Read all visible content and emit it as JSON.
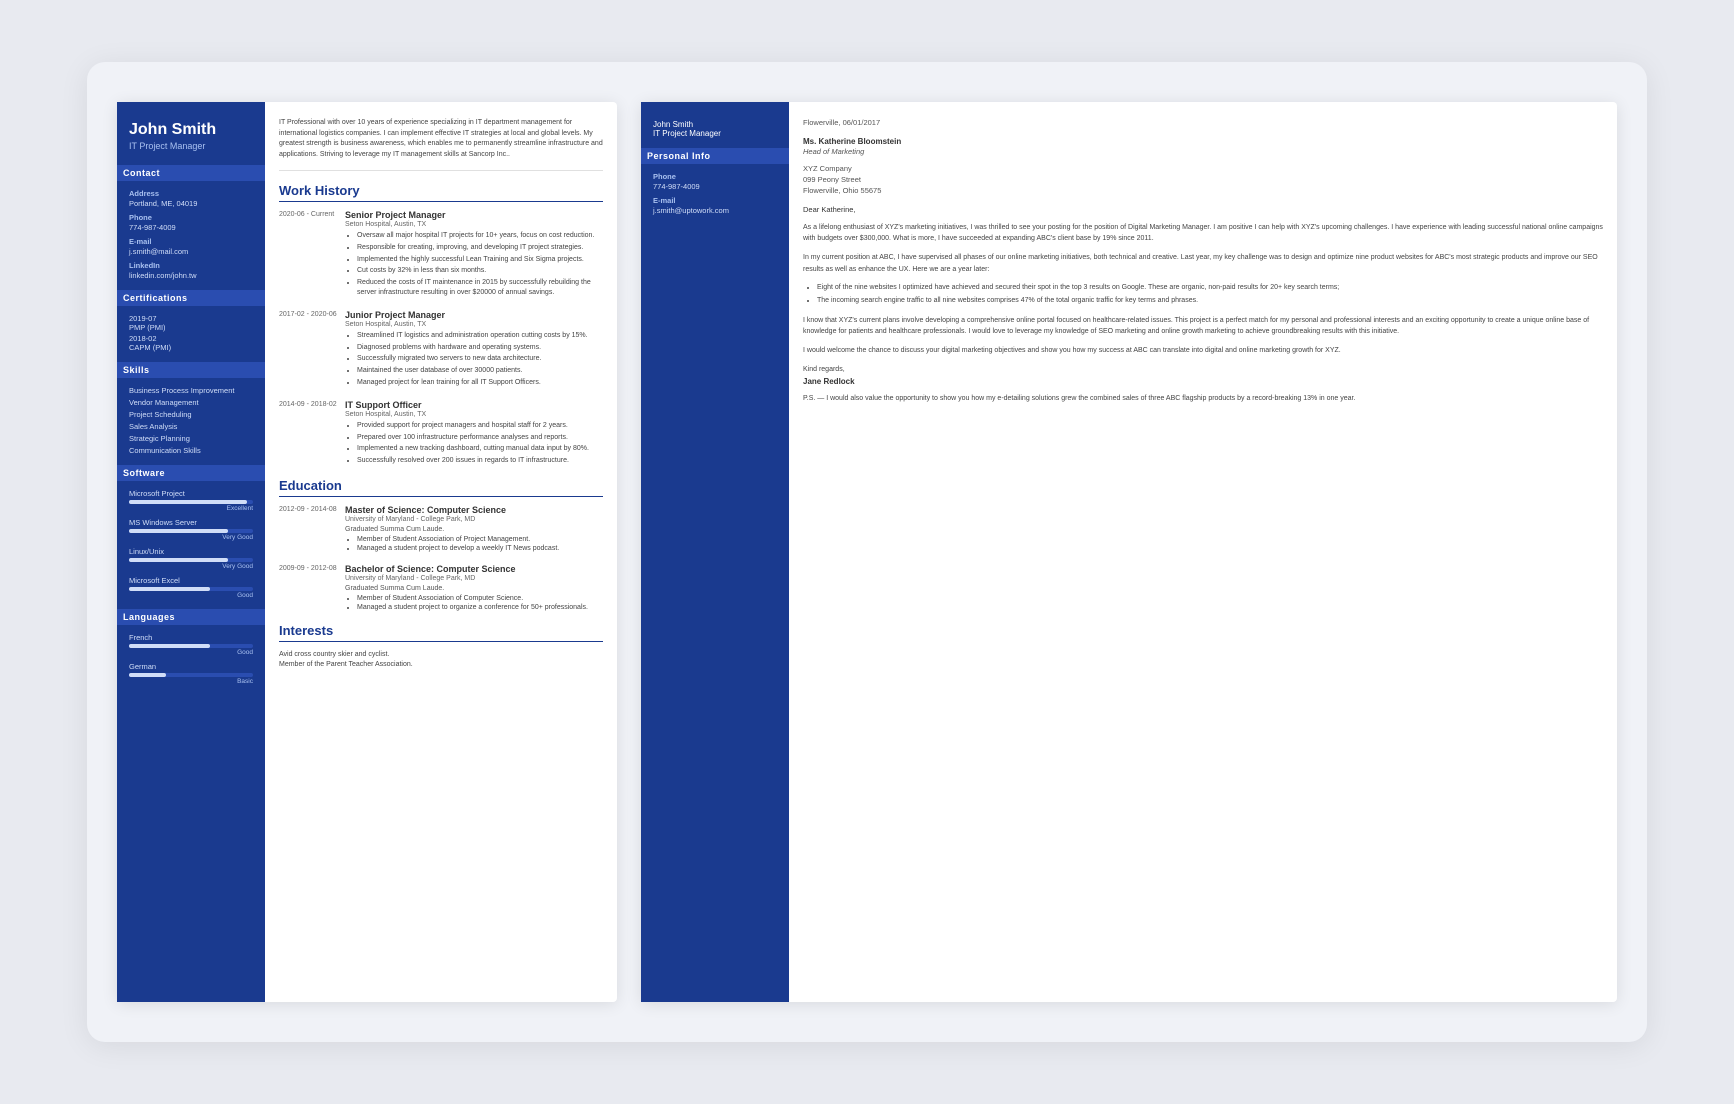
{
  "resume": {
    "name": "John Smith",
    "title": "IT Project Manager",
    "contact": {
      "section_label": "Contact",
      "address_label": "Address",
      "address_value": "Portland, ME, 04019",
      "phone_label": "Phone",
      "phone_value": "774-987-4009",
      "email_label": "E-mail",
      "email_value": "j.smith@mail.com",
      "linkedin_label": "LinkedIn",
      "linkedin_value": "linkedin.com/john.tw"
    },
    "certifications": {
      "section_label": "Certifications",
      "items": [
        {
          "date": "2019-07",
          "name": "PMP (PMI)"
        },
        {
          "date": "2018-02",
          "name": "CAPM (PMI)"
        }
      ]
    },
    "skills": {
      "section_label": "Skills",
      "items": [
        "Business Process Improvement",
        "Vendor Management",
        "Project Scheduling",
        "Sales Analysis",
        "Strategic Planning",
        "Communication Skills"
      ]
    },
    "software": {
      "section_label": "Software",
      "items": [
        {
          "name": "Microsoft Project",
          "level": "Excellent",
          "pct": 95
        },
        {
          "name": "MS Windows Server",
          "level": "Very Good",
          "pct": 80
        },
        {
          "name": "Linux/Unix",
          "level": "Very Good",
          "pct": 80
        },
        {
          "name": "Microsoft Excel",
          "level": "Good",
          "pct": 65
        }
      ]
    },
    "languages": {
      "section_label": "Languages",
      "items": [
        {
          "name": "French",
          "level": "Good",
          "pct": 65
        },
        {
          "name": "German",
          "level": "Basic",
          "pct": 30
        }
      ]
    },
    "summary": "IT Professional with over 10 years of experience specializing in IT department management for international logistics companies. I can implement effective IT strategies at local and global levels. My greatest strength is business awareness, which enables me to permanently streamline infrastructure and applications. Striving to leverage my IT management skills at Sancorp Inc..",
    "work_history": {
      "section_label": "Work History",
      "entries": [
        {
          "date": "2020-06 - Current",
          "title": "Senior Project Manager",
          "company": "Seton Hospital, Austin, TX",
          "bullets": [
            "Oversaw all major hospital IT projects for 10+ years, focus on cost reduction.",
            "Responsible for creating, improving, and developing IT project strategies.",
            "Implemented the highly successful Lean Training and Six Sigma projects.",
            "Cut costs by 32% in less than six months.",
            "Reduced the costs of IT maintenance in 2015 by successfully rebuilding the server infrastructure resulting in over $20000 of annual savings."
          ]
        },
        {
          "date": "2017-02 - 2020-06",
          "title": "Junior Project Manager",
          "company": "Seton Hospital, Austin, TX",
          "bullets": [
            "Streamlined IT logistics and administration operation cutting costs by 15%.",
            "Diagnosed problems with hardware and operating systems.",
            "Successfully migrated two servers to new data architecture.",
            "Maintained the user database of over 30000 patients.",
            "Managed project for lean training for all IT Support Officers."
          ]
        },
        {
          "date": "2014-09 - 2018-02",
          "title": "IT Support Officer",
          "company": "Seton Hospital, Austin, TX",
          "bullets": [
            "Provided support for project managers and hospital staff for 2 years.",
            "Prepared over 100 infrastructure performance analyses and reports.",
            "Implemented a new tracking dashboard, cutting manual data input by 80%.",
            "Successfully resolved over 200 issues in regards to IT infrastructure."
          ]
        }
      ]
    },
    "education": {
      "section_label": "Education",
      "entries": [
        {
          "date": "2012-09 - 2014-08",
          "degree": "Master of Science: Computer Science",
          "school": "University of Maryland - College Park, MD",
          "note": "Graduated Summa Cum Laude.",
          "bullets": [
            "Member of Student Association of Project Management.",
            "Managed a student project to develop a weekly IT News podcast."
          ]
        },
        {
          "date": "2009-09 - 2012-08",
          "degree": "Bachelor of Science: Computer Science",
          "school": "University of Maryland - College Park, MD",
          "note": "Graduated Summa Cum Laude.",
          "bullets": [
            "Member of Student Association of Computer Science.",
            "Managed a student project to organize a conference for 50+ professionals."
          ]
        }
      ]
    },
    "interests": {
      "section_label": "Interests",
      "text": "Avid cross country skier and cyclist.\nMember of the Parent Teacher Association."
    }
  },
  "cover_letter": {
    "name": "John Smith",
    "title": "IT Project Manager",
    "contact": {
      "section_label": "Personal Info",
      "phone_label": "Phone",
      "phone_value": "774-987-4009",
      "email_label": "E-mail",
      "email_value": "j.smith@uptowork.com"
    },
    "date": "Flowerville, 06/01/2017",
    "recipient": {
      "name": "Ms. Katherine Bloomstein",
      "title": "Head of Marketing",
      "company": "XYZ Company",
      "address1": "099 Peony Street",
      "address2": "Flowerville, Ohio 55675"
    },
    "greeting": "Dear Katherine,",
    "paragraphs": [
      "As a lifelong enthusiast of XYZ's marketing initiatives, I was thrilled to see your posting for the position of Digital Marketing Manager. I am positive I can help with XYZ's upcoming challenges. I have experience with leading successful national online campaigns with budgets over $300,000. What is more, I have succeeded at expanding ABC's client base by 19% since 2011.",
      "In my current position at ABC, I have supervised all phases of our online marketing initiatives, both technical and creative. Last year, my key challenge was to design and optimize nine product websites for ABC's most strategic products and improve our SEO results as well as enhance the UX. Here we are a year later:",
      "I know that XYZ's current plans involve developing a comprehensive online portal focused on healthcare-related issues. This project is a perfect match for my personal and professional interests and an exciting opportunity to create a unique online base of knowledge for patients and healthcare professionals. I would love to leverage my knowledge of SEO marketing and online growth marketing to achieve groundbreaking results with this initiative.",
      "I would welcome the chance to discuss your digital marketing objectives and show you how my success at ABC can translate into digital and online marketing growth for XYZ."
    ],
    "bullets": [
      "Eight of the nine websites I optimized have achieved and secured their spot in the top 3 results on Google. These are organic, non-paid results for 20+ key search terms;",
      "The incoming search engine traffic to all nine websites comprises 47% of the total organic traffic for key terms and phrases."
    ],
    "closing": "Kind regards,",
    "signature": "Jane Redlock",
    "ps": "P.S. — I would also value the opportunity to show you how my e-detailing solutions grew the combined sales of three ABC flagship products by a record-breaking 13% in one year."
  }
}
